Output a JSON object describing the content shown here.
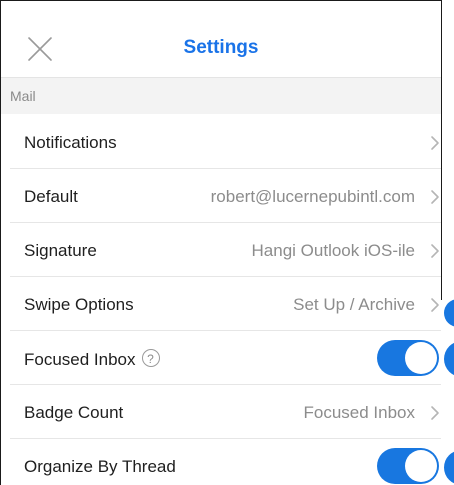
{
  "header": {
    "title": "Settings",
    "close_icon": "close-icon"
  },
  "section": {
    "label": "Mail"
  },
  "rows": [
    {
      "label": "Notifications",
      "value": "",
      "control": "chevron"
    },
    {
      "label": "Default",
      "value": "robert@lucernepubintl.com",
      "control": "chevron"
    },
    {
      "label": "Signature",
      "value": "Hangi Outlook iOS-ile",
      "control": "chevron"
    },
    {
      "label": "Swipe Options",
      "value": "Set Up / Archive",
      "control": "chevron"
    },
    {
      "label": "Focused Inbox",
      "value": "",
      "control": "toggle",
      "toggle_on": true,
      "help_icon": "?"
    },
    {
      "label": "Badge Count",
      "value": "Focused Inbox",
      "control": "chevron"
    },
    {
      "label": "Organize By Thread",
      "value": "",
      "control": "toggle",
      "toggle_on": true
    }
  ],
  "colors": {
    "accent": "#1877e0",
    "title": "#1a73e8",
    "section_bg": "#f3f3f3",
    "secondary_text": "#8c8c8c"
  }
}
